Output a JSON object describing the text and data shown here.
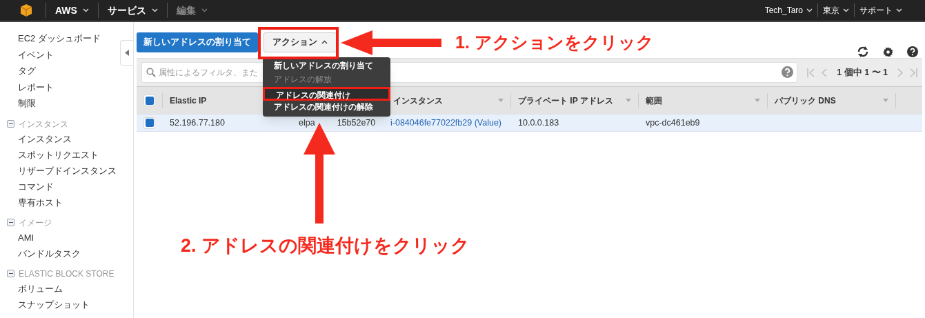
{
  "top_nav": {
    "menus": [
      {
        "label": "AWS",
        "disabled": false
      },
      {
        "label": "サービス",
        "disabled": false
      },
      {
        "label": "編集",
        "disabled": true
      }
    ],
    "right_menus": [
      "Tech_Taro",
      "東京",
      "サポート"
    ]
  },
  "sidebar": {
    "items": [
      "EC2 ダッシュボード",
      "イベント",
      "タグ",
      "レポート",
      "制限"
    ],
    "sections": [
      {
        "title": "インスタンス",
        "expanded": true,
        "items": [
          "インスタンス",
          "スポットリクエスト",
          "リザーブドインスタンス",
          "コマンド",
          "専有ホスト"
        ]
      },
      {
        "title": "イメージ",
        "expanded": true,
        "items": [
          "AMI",
          "バンドルタスク"
        ]
      },
      {
        "title": "ELASTIC BLOCK STORE",
        "expanded": true,
        "items": [
          "ボリューム",
          "スナップショット"
        ]
      }
    ]
  },
  "toolbar": {
    "primary_button": "新しいアドレスの割り当て",
    "actions_button": "アクション"
  },
  "actions_menu": [
    {
      "label": "新しいアドレスの割り当て",
      "disabled": false,
      "highlighted": false
    },
    {
      "label": "アドレスの解放",
      "disabled": true,
      "highlighted": false
    },
    {
      "label": "アドレスの関連付け",
      "disabled": false,
      "highlighted": true
    },
    {
      "label": "アドレスの関連付けの解除",
      "disabled": false,
      "highlighted": false
    }
  ],
  "filter": {
    "placeholder": "属性によるフィルタ、また",
    "pagination": "1 個中 1 〜 1"
  },
  "table": {
    "header_checked": true,
    "columns": [
      {
        "label": "Elastic IP"
      },
      {},
      {
        "label": "インスタンス",
        "sort_caret": true
      },
      {
        "label": "プライベート IP アドレス",
        "sort_caret": true
      },
      {
        "label": "範囲",
        "sort_caret": true
      },
      {
        "label": "パブリック DNS",
        "sort_caret": true
      }
    ],
    "rows": [
      {
        "checked": true,
        "cells": [
          "52.196.77.180",
          [
            "elpa",
            "15b52e70"
          ],
          "i-084046fe77022fb29 (Value)",
          "10.0.0.183",
          "vpc-dc461eb9",
          ""
        ]
      }
    ]
  },
  "annotations": [
    {
      "kind": "arrow-left",
      "text": "1. アクションをクリック"
    },
    {
      "kind": "arrow-up",
      "text": "2. アドレスの関連付けをクリック"
    }
  ]
}
